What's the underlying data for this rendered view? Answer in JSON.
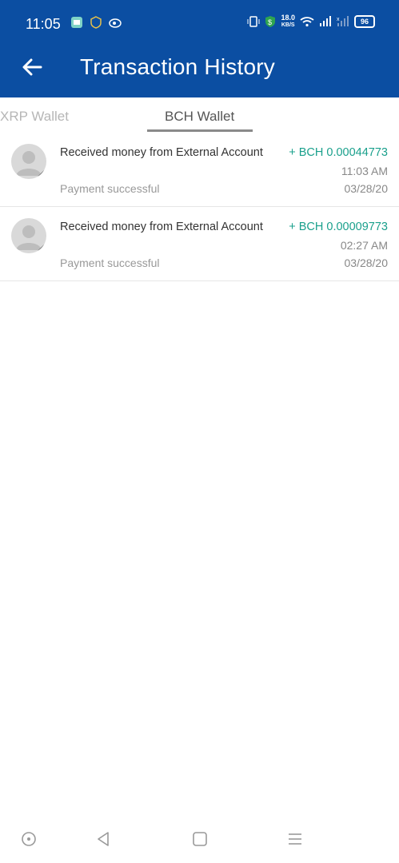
{
  "status_bar": {
    "time": "11:05",
    "net_speed_value": "18.0",
    "net_speed_unit": "KB/S",
    "battery": "96"
  },
  "header": {
    "title": "Transaction History",
    "back_icon": "arrow-left-icon",
    "color": "#0b4ea2"
  },
  "tabs": {
    "items": [
      {
        "label": "XRP Wallet",
        "selected": false
      },
      {
        "label": "BCH Wallet",
        "selected": true
      }
    ]
  },
  "transactions": [
    {
      "description": "Received money from External Account",
      "amount": "+ BCH 0.00044773",
      "time": "11:03 AM",
      "status": "Payment successful",
      "date": "03/28/20"
    },
    {
      "description": "Received money from External Account",
      "amount": "+ BCH 0.00009773",
      "time": "02:27 AM",
      "status": "Payment successful",
      "date": "03/28/20"
    }
  ],
  "colors": {
    "amount": "#1aa08c"
  },
  "nav_bar": {
    "icons": [
      "circle-icon",
      "back-triangle-icon",
      "square-icon",
      "menu-icon"
    ]
  }
}
